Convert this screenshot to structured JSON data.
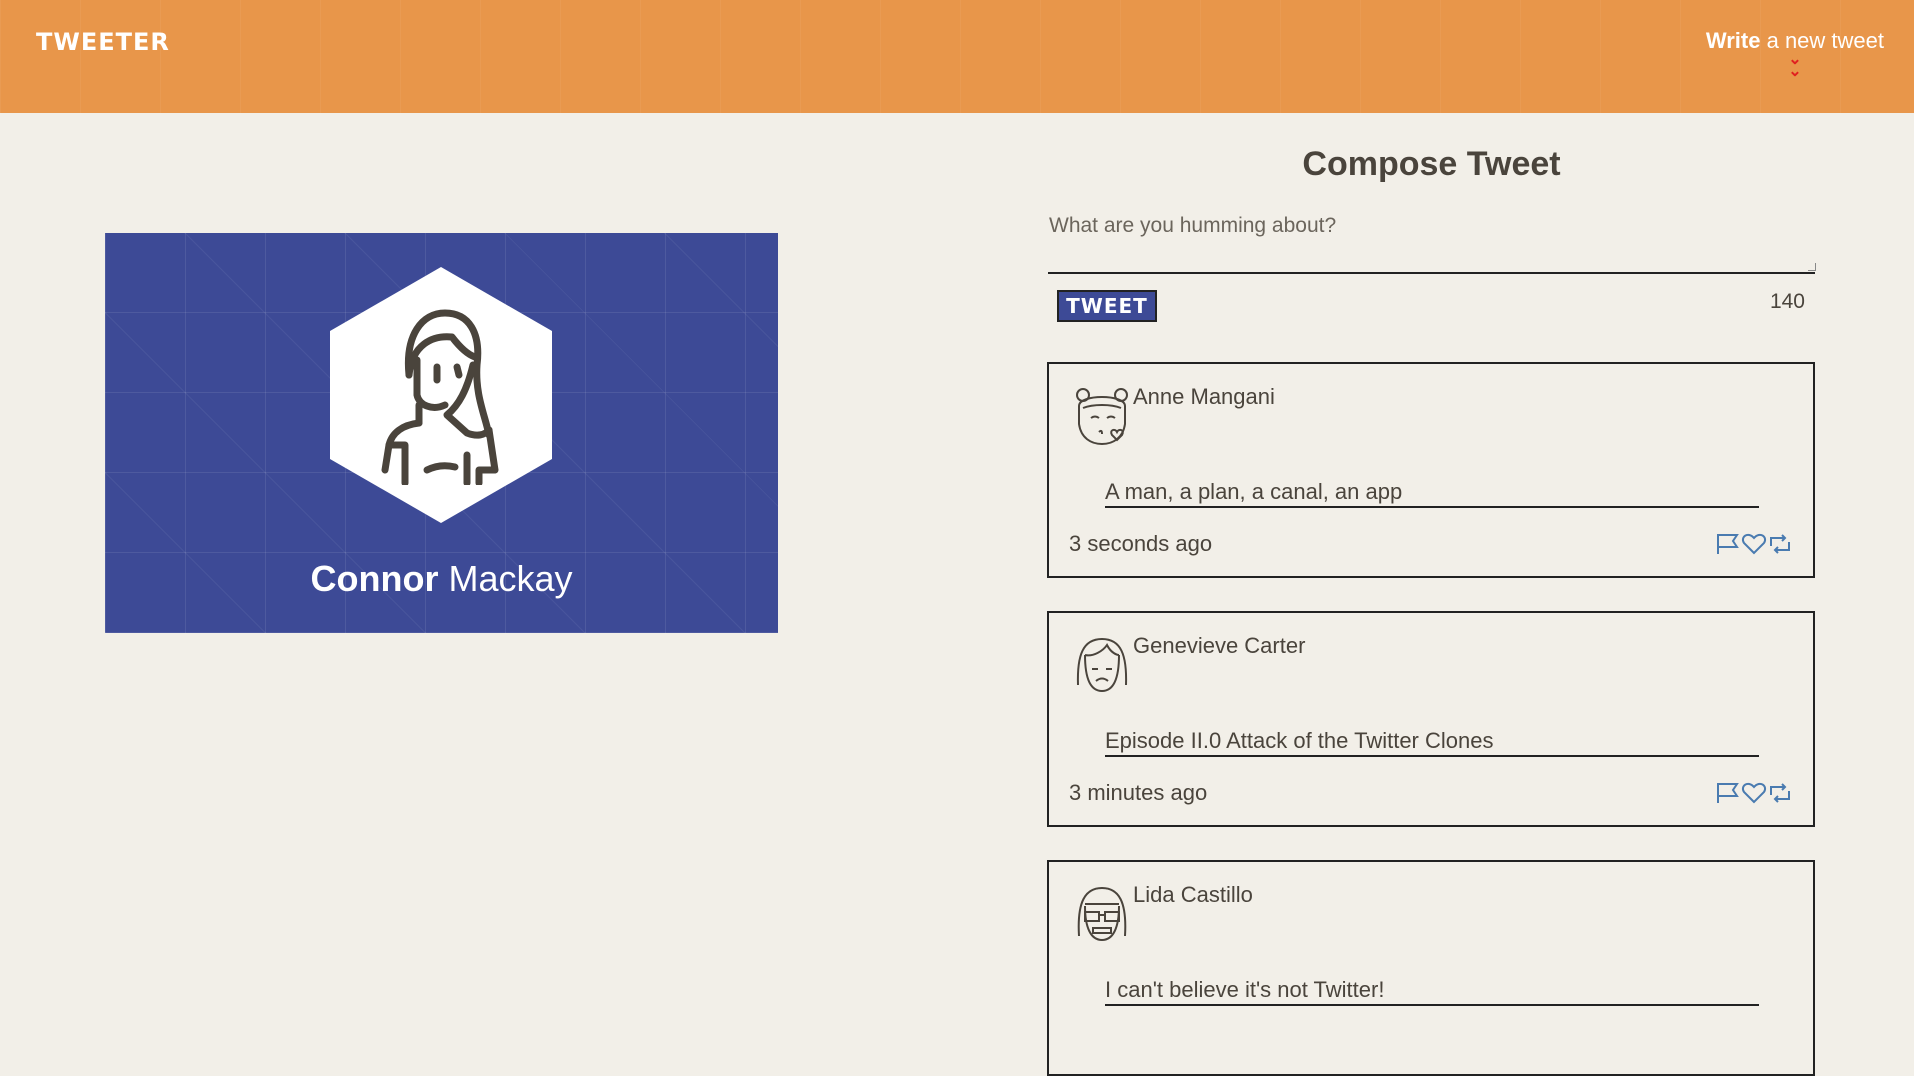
{
  "nav": {
    "brand": "TWEETER",
    "write_bold": "Write",
    "write_rest": " a new tweet",
    "chevron_icon": "double-chevron-down"
  },
  "profile": {
    "first_name": "Connor",
    "last_name": " Mackay",
    "bg_color": "#3d4a96"
  },
  "compose": {
    "title": "Compose Tweet",
    "placeholder": "What are you humming about?",
    "button_label": "TWEET",
    "counter": "140"
  },
  "tweets": [
    {
      "author": "Anne Mangani",
      "content": "A man, a plan, a canal, an app",
      "time": "3 seconds ago",
      "avatar": "girl-kiss-avatar"
    },
    {
      "author": "Genevieve Carter",
      "content": "Episode II.0 Attack of the Twitter Clones",
      "time": "3 minutes ago",
      "avatar": "girl-sad-avatar"
    },
    {
      "author": "Lida Castillo",
      "content": "I can't believe it's not Twitter!",
      "time": "",
      "avatar": "girl-sunglasses-avatar"
    }
  ],
  "colors": {
    "header": "#e8964a",
    "background": "#f2efe8",
    "accent": "#3d4a96",
    "action_icons": "#4a7bb0"
  }
}
